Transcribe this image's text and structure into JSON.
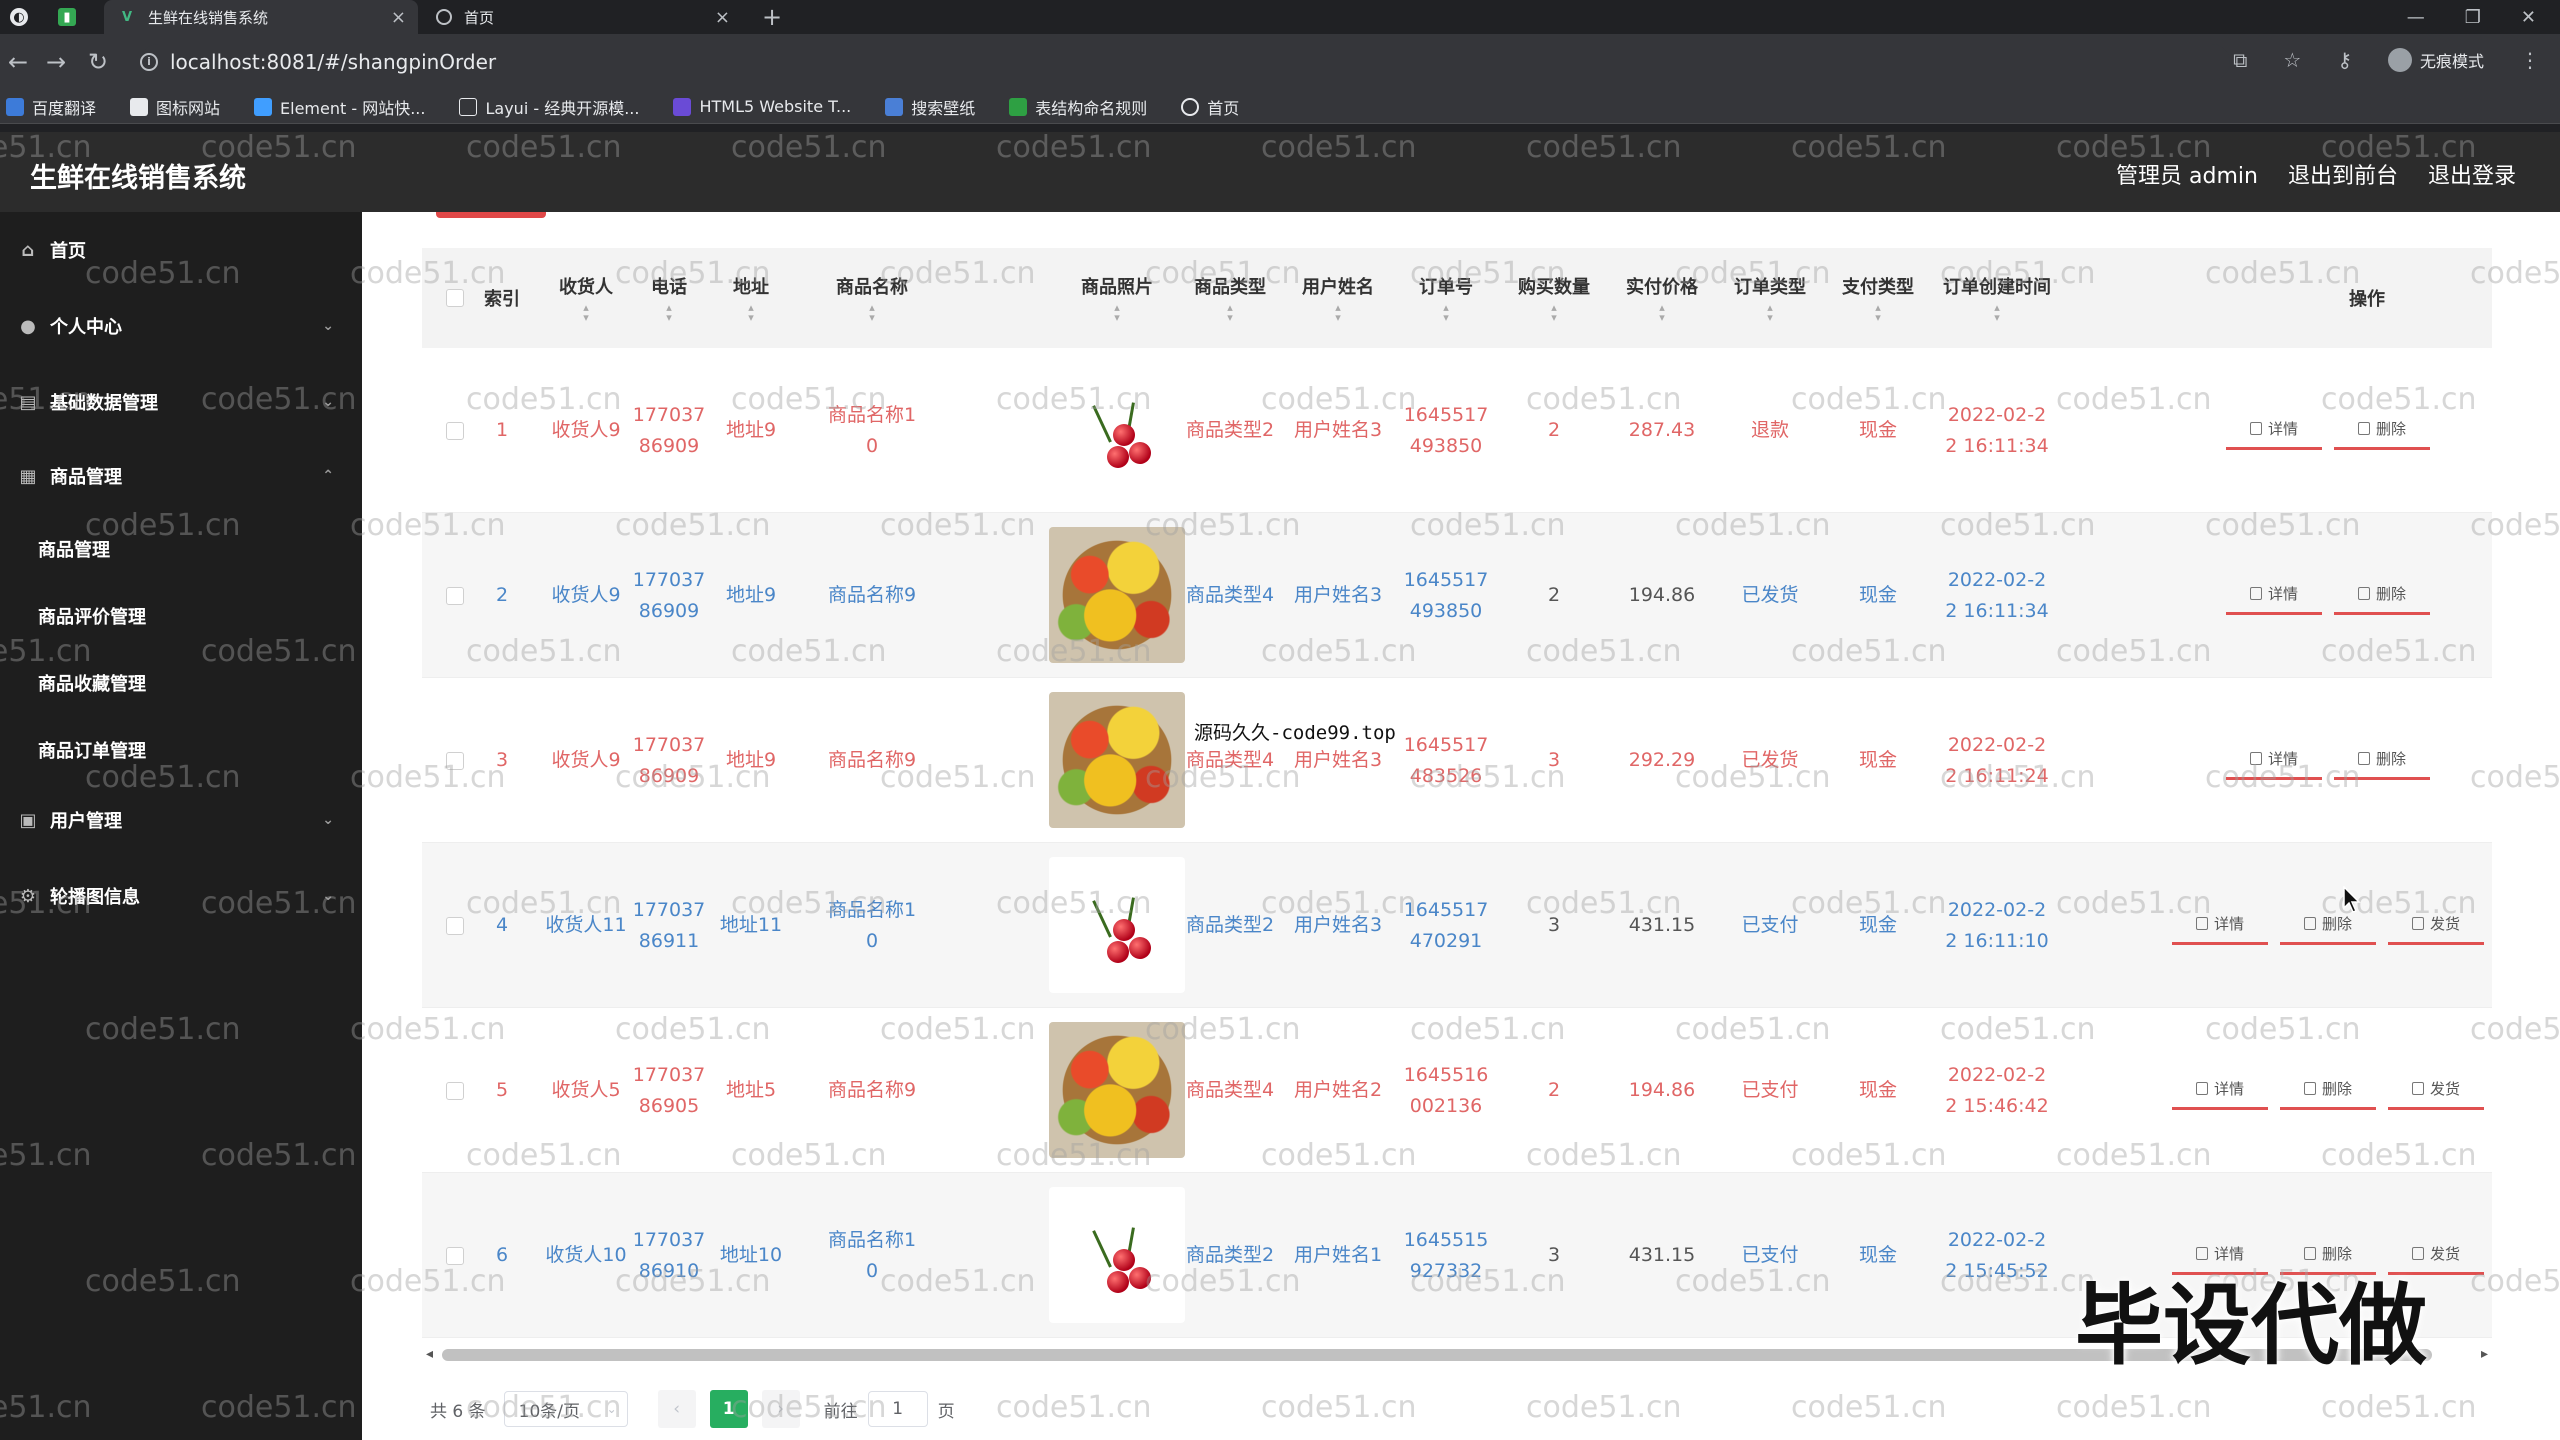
{
  "browser": {
    "tabs": [
      {
        "title": "生鲜在线销售系统",
        "active": true
      },
      {
        "title": "首页",
        "active": false
      }
    ],
    "url": "localhost:8081/#/shangpinOrder",
    "incognito_label": "无痕模式",
    "bookmarks": [
      "百度翻译",
      "图标网站",
      "Element - 网站快...",
      "Layui - 经典开源模...",
      "HTML5 Website T...",
      "搜索壁纸",
      "表结构命名规则",
      "首页"
    ]
  },
  "app": {
    "title": "生鲜在线销售系统",
    "header_links": [
      "管理员 admin",
      "退出到前台",
      "退出登录"
    ]
  },
  "sidebar": {
    "items": [
      {
        "label": "首页",
        "icon": "home-icon",
        "chevron": ""
      },
      {
        "label": "个人中心",
        "icon": "user-icon",
        "chevron": "⌄"
      },
      {
        "label": "基础数据管理",
        "icon": "list-icon",
        "chevron": "⌄"
      },
      {
        "label": "商品管理",
        "icon": "box-icon",
        "chevron": "⌃"
      }
    ],
    "sub_items": [
      "商品管理",
      "商品评价管理",
      "商品收藏管理",
      "商品订单管理"
    ],
    "items_after": [
      {
        "label": "用户管理",
        "icon": "image-icon",
        "chevron": "⌄"
      },
      {
        "label": "轮播图信息",
        "icon": "gear-icon",
        "chevron": "⌄"
      }
    ]
  },
  "table": {
    "headers": [
      {
        "label": "索引",
        "sort": false
      },
      {
        "label": "收货人",
        "sort": true
      },
      {
        "label": "电话",
        "sort": true
      },
      {
        "label": "地址",
        "sort": true
      },
      {
        "label": "商品名称",
        "sort": true
      },
      {
        "label": "商品照片",
        "sort": true
      },
      {
        "label": "商品类型",
        "sort": true
      },
      {
        "label": "用户姓名",
        "sort": true
      },
      {
        "label": "订单号",
        "sort": true
      },
      {
        "label": "购买数量",
        "sort": true
      },
      {
        "label": "实付价格",
        "sort": true
      },
      {
        "label": "订单类型",
        "sort": true
      },
      {
        "label": "支付类型",
        "sort": true
      },
      {
        "label": "订单创建时间",
        "sort": true
      },
      {
        "label": "操作",
        "sort": false
      }
    ],
    "rows": [
      {
        "index": "1",
        "receiver": "收货人9",
        "phone": "17703786909",
        "address": "地址9",
        "product": "商品名称10",
        "photo": "cherry",
        "type": "商品类型2",
        "user": "用户姓名3",
        "order_no": "1645517493850",
        "qty": "2",
        "price": "287.43",
        "order_type": "退款",
        "pay": "现金",
        "created": "2022-02-22 16:11:34",
        "color": "#e06666",
        "actions": [
          "详情",
          "删除"
        ]
      },
      {
        "index": "2",
        "receiver": "收货人9",
        "phone": "17703786909",
        "address": "地址9",
        "product": "商品名称9",
        "photo": "fruit",
        "type": "商品类型4",
        "user": "用户姓名3",
        "order_no": "1645517493850",
        "qty": "2",
        "price": "194.86",
        "order_type": "已发货",
        "pay": "现金",
        "created": "2022-02-22 16:11:34",
        "color": "#4a86c8",
        "actions": [
          "详情",
          "删除"
        ]
      },
      {
        "index": "3",
        "receiver": "收货人9",
        "phone": "17703786909",
        "address": "地址9",
        "product": "商品名称9",
        "photo": "fruit",
        "type": "商品类型4",
        "user": "用户姓名3",
        "order_no": "1645517483526",
        "qty": "3",
        "price": "292.29",
        "order_type": "已发货",
        "pay": "现金",
        "created": "2022-02-22 16:11:24",
        "color": "#e06666",
        "actions": [
          "详情",
          "删除"
        ]
      },
      {
        "index": "4",
        "receiver": "收货人11",
        "phone": "17703786911",
        "address": "地址11",
        "product": "商品名称10",
        "photo": "cherry",
        "type": "商品类型2",
        "user": "用户姓名3",
        "order_no": "1645517470291",
        "qty": "3",
        "price": "431.15",
        "order_type": "已支付",
        "pay": "现金",
        "created": "2022-02-22 16:11:10",
        "color": "#4a86c8",
        "actions": [
          "详情",
          "删除",
          "发货"
        ]
      },
      {
        "index": "5",
        "receiver": "收货人5",
        "phone": "17703786905",
        "address": "地址5",
        "product": "商品名称9",
        "photo": "fruit",
        "type": "商品类型4",
        "user": "用户姓名2",
        "order_no": "1645516002136",
        "qty": "2",
        "price": "194.86",
        "order_type": "已支付",
        "pay": "现金",
        "created": "2022-02-22 15:46:42",
        "color": "#e06666",
        "actions": [
          "详情",
          "删除",
          "发货"
        ]
      },
      {
        "index": "6",
        "receiver": "收货人10",
        "phone": "17703786910",
        "address": "地址10",
        "product": "商品名称10",
        "photo": "cherry",
        "type": "商品类型2",
        "user": "用户姓名1",
        "order_no": "1645515927332",
        "qty": "3",
        "price": "431.15",
        "order_type": "已支付",
        "pay": "现金",
        "created": "2022-02-22 15:45:52",
        "color": "#4a86c8",
        "actions": [
          "详情",
          "删除",
          "发货"
        ]
      }
    ]
  },
  "pagination": {
    "total": "共 6 条",
    "page_size": "10条/页",
    "prev": "‹",
    "current": "1",
    "next": "›",
    "goto_label": "前往",
    "goto_value": "1",
    "page_suffix": "页"
  },
  "watermark": "code51.cn",
  "overlay_note": "源码久久-code99.top",
  "banner": "毕设代做",
  "colors": {
    "accent": "#27ae60",
    "danger": "#e05050",
    "header_bg": "#2c2c2c",
    "sidebar_bg": "#1e1e1e"
  }
}
